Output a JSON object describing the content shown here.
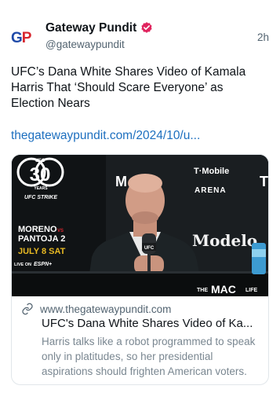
{
  "account": {
    "avatar_text_1": "G",
    "avatar_text_2": "P",
    "name": "Gateway Pundit",
    "handle": "@gatewaypundit",
    "verified_icon": "verified-badge-icon",
    "badge_color": "#e0245e"
  },
  "post": {
    "timestamp": "2h",
    "text": "UFC’s Dana White Shares Video of Kamala Harris That ‘Should Scare Everyone’ as Election Nears",
    "link": "thegatewaypundit.com/2024/10/u..."
  },
  "card": {
    "domain": "www.thegatewaypundit.com",
    "title": "UFC's Dana White Shares Video of Ka...",
    "description": "Harris talks like a robot programmed to speak only in platitudes, so her presidential aspirations should frighten American voters.",
    "link_icon": "link-icon",
    "image": {
      "ufc_logo": "UFC",
      "anniversary_number": "30",
      "anniversary_years": "YEARS",
      "ufc_strike": "UFC STRIKE",
      "fighter_1": "MORENO",
      "vs": "VS",
      "fighter_2": "PANTOJA 2",
      "event_date": "JULY 8 SAT",
      "live_on": "LIVE ON",
      "network": "ESPN+",
      "sponsor_1": "T·Mobile",
      "sponsor_1_sub": "ARENA",
      "sponsor_2": "Modelo",
      "mic_logo": "UFC",
      "partial_letter_1": "M",
      "partial_letter_2": "T",
      "watermark_1": "THE",
      "watermark_2": "MAC",
      "watermark_3": "LIFE"
    }
  }
}
